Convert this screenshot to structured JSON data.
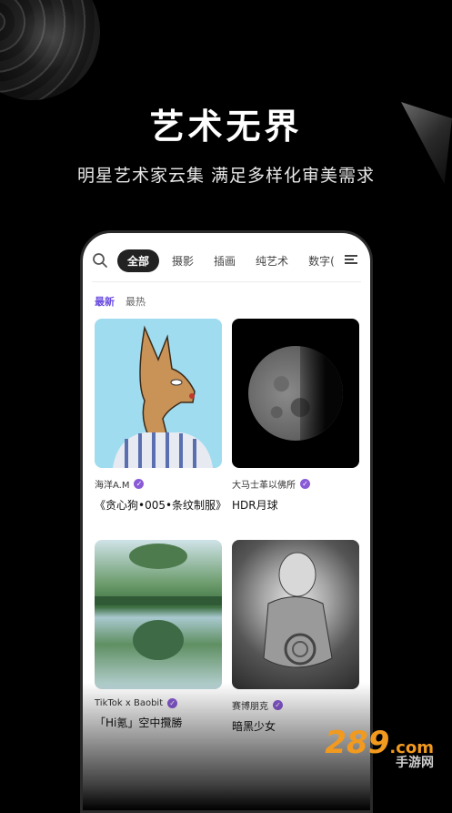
{
  "hero": {
    "headline": "艺术无界",
    "subline": "明星艺术家云集 满足多样化审美需求"
  },
  "tabs": [
    {
      "label": "全部",
      "active": true
    },
    {
      "label": "摄影",
      "active": false
    },
    {
      "label": "插画",
      "active": false
    },
    {
      "label": "纯艺术",
      "active": false
    },
    {
      "label": "数字(",
      "active": false
    }
  ],
  "sort": {
    "newest": "最新",
    "hottest": "最热"
  },
  "cards": [
    {
      "author": "海洋A.M",
      "title": "《贪心狗•005•条纹制服》"
    },
    {
      "author": "大马士革以佛所",
      "title": "HDR月球"
    },
    {
      "author": "TikTok x Baobit",
      "title": "「Hi氪」空中攬勝"
    },
    {
      "author": "赛博朋克",
      "title": "暗黑少女"
    }
  ],
  "watermark": {
    "brand": "289",
    "domain": ".com",
    "sub": "手游网"
  },
  "colors": {
    "accent": "#6a4de0",
    "badge": "#8a5bd6",
    "background": "#000000"
  },
  "icons": [
    "search-icon",
    "menu-icon",
    "verified-icon"
  ]
}
